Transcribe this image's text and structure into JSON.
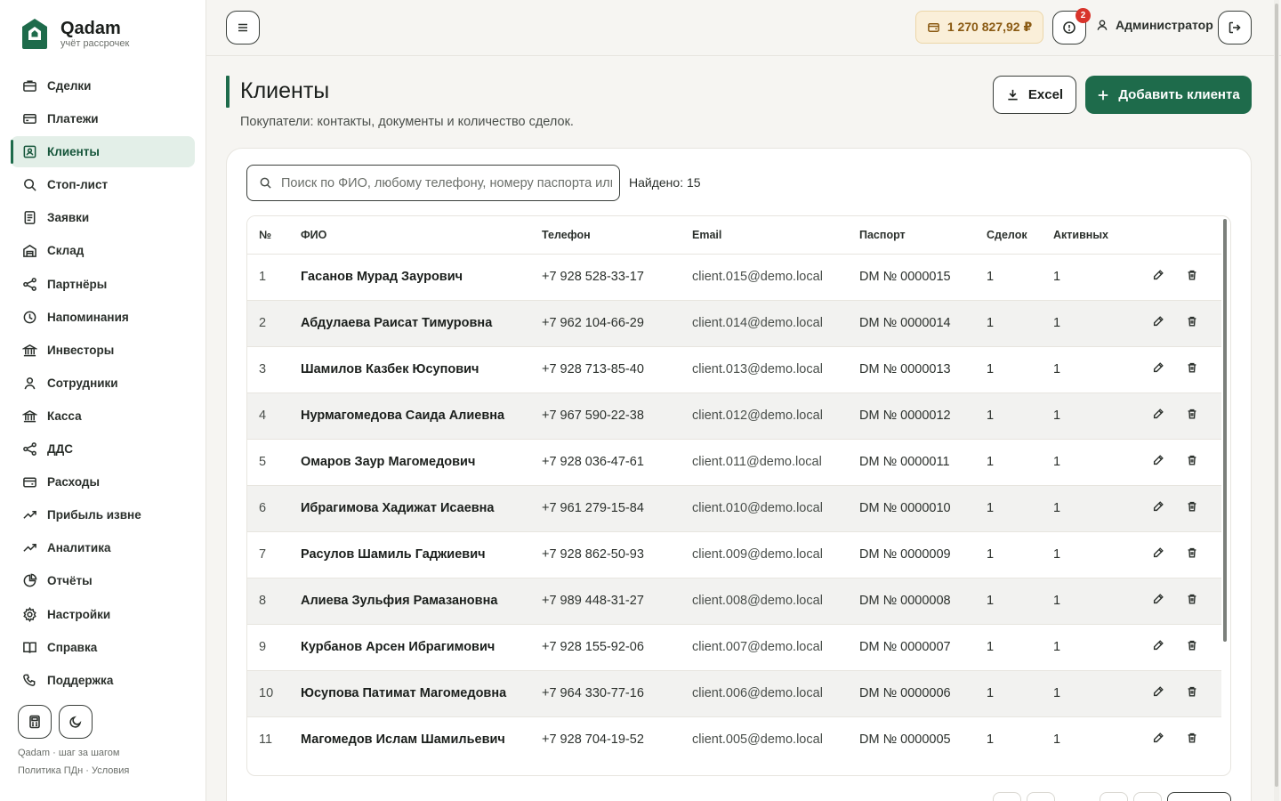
{
  "brand": {
    "name": "Qadam",
    "subtitle": "учёт рассрочек"
  },
  "sidebar": {
    "items": [
      {
        "label": "Сделки",
        "icon": "briefcase-icon"
      },
      {
        "label": "Платежи",
        "icon": "card-icon"
      },
      {
        "label": "Клиенты",
        "icon": "contact-icon",
        "active": true
      },
      {
        "label": "Стоп-лист",
        "icon": "search-icon"
      },
      {
        "label": "Заявки",
        "icon": "document-icon"
      },
      {
        "label": "Склад",
        "icon": "warehouse-icon"
      },
      {
        "label": "Партнёры",
        "icon": "share-icon"
      },
      {
        "label": "Напоминания",
        "icon": "clock-icon"
      },
      {
        "label": "Инвесторы",
        "icon": "bank-icon"
      },
      {
        "label": "Сотрудники",
        "icon": "user-icon"
      },
      {
        "label": "Касса",
        "icon": "bank-icon"
      },
      {
        "label": "ДДС",
        "icon": "share-icon"
      },
      {
        "label": "Расходы",
        "icon": "wallet-icon"
      },
      {
        "label": "Прибыль извне",
        "icon": "trend-icon"
      },
      {
        "label": "Аналитика",
        "icon": "trend-icon"
      },
      {
        "label": "Отчёты",
        "icon": "pie-icon"
      },
      {
        "label": "Настройки",
        "icon": "gear-icon"
      },
      {
        "label": "Справка",
        "icon": "book-icon"
      },
      {
        "label": "Поддержка",
        "icon": "phone-icon"
      }
    ],
    "footer_line1": "Qadam · шаг за шагом",
    "footer_line2": "Политика ПДн · Условия"
  },
  "topbar": {
    "balance": "1 270 827,92 ₽",
    "alerts_count": "2",
    "user_name": "Администратор"
  },
  "page": {
    "title": "Клиенты",
    "subtitle": "Покупатели: контакты, документы и количество сделок.",
    "excel_label": "Excel",
    "add_label": "Добавить клиента"
  },
  "search": {
    "placeholder": "Поиск по ФИО, любому телефону, номеру паспорта или email",
    "found": "Найдено: 15"
  },
  "table": {
    "columns": [
      "№",
      "ФИО",
      "Телефон",
      "Email",
      "Паспорт",
      "Сделок",
      "Активных"
    ],
    "rows": [
      {
        "n": "1",
        "name": "Гасанов Мурад Заурович",
        "phone": "+7 928 528-33-17",
        "email": "client.015@demo.local",
        "passport": "DM № 0000015",
        "deals": "1",
        "active": "1"
      },
      {
        "n": "2",
        "name": "Абдулаева Раисат Тимуровна",
        "phone": "+7 962 104-66-29",
        "email": "client.014@demo.local",
        "passport": "DM № 0000014",
        "deals": "1",
        "active": "1"
      },
      {
        "n": "3",
        "name": "Шамилов Казбек Юсупович",
        "phone": "+7 928 713-85-40",
        "email": "client.013@demo.local",
        "passport": "DM № 0000013",
        "deals": "1",
        "active": "1"
      },
      {
        "n": "4",
        "name": "Нурмагомедова Саида Алиевна",
        "phone": "+7 967 590-22-38",
        "email": "client.012@demo.local",
        "passport": "DM № 0000012",
        "deals": "1",
        "active": "1"
      },
      {
        "n": "5",
        "name": "Омаров Заур Магомедович",
        "phone": "+7 928 036-47-61",
        "email": "client.011@demo.local",
        "passport": "DM № 0000011",
        "deals": "1",
        "active": "1"
      },
      {
        "n": "6",
        "name": "Ибрагимова Хадижат Исаевна",
        "phone": "+7 961 279-15-84",
        "email": "client.010@demo.local",
        "passport": "DM № 0000010",
        "deals": "1",
        "active": "1"
      },
      {
        "n": "7",
        "name": "Расулов Шамиль Гаджиевич",
        "phone": "+7 928 862-50-93",
        "email": "client.009@demo.local",
        "passport": "DM № 0000009",
        "deals": "1",
        "active": "1"
      },
      {
        "n": "8",
        "name": "Алиева Зульфия Рамазановна",
        "phone": "+7 989 448-31-27",
        "email": "client.008@demo.local",
        "passport": "DM № 0000008",
        "deals": "1",
        "active": "1"
      },
      {
        "n": "9",
        "name": "Курбанов Арсен Ибрагимович",
        "phone": "+7 928 155-92-06",
        "email": "client.007@demo.local",
        "passport": "DM № 0000007",
        "deals": "1",
        "active": "1"
      },
      {
        "n": "10",
        "name": "Юсупова Патимат Магомедовна",
        "phone": "+7 964 330-77-16",
        "email": "client.006@demo.local",
        "passport": "DM № 0000006",
        "deals": "1",
        "active": "1"
      },
      {
        "n": "11",
        "name": "Магомедов Ислам Шамильевич",
        "phone": "+7 928 704-19-52",
        "email": "client.005@demo.local",
        "passport": "DM № 0000005",
        "deals": "1",
        "active": "1"
      }
    ]
  },
  "colors": {
    "accent": "#1e6b4b",
    "balance_bg": "#faefd9",
    "badge": "#d8342b"
  }
}
